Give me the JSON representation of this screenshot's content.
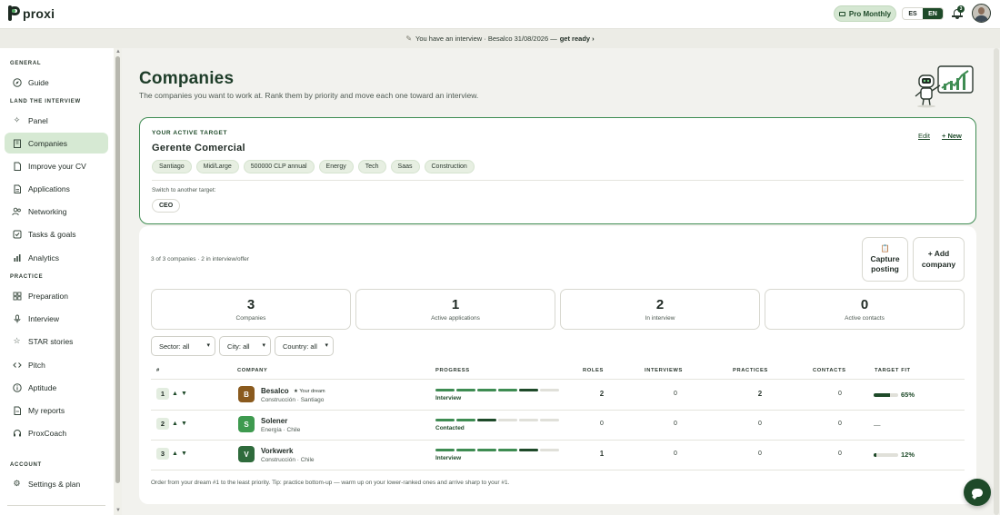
{
  "app": {
    "brand": "proxi"
  },
  "topbar": {
    "plan_label": "Pro Monthly",
    "lang_es": "ES",
    "lang_en": "EN",
    "notifications": "3"
  },
  "banner": {
    "text": "You have an interview · Besalco 31/08/2026 —",
    "cta": "get ready ›"
  },
  "sidebar": {
    "sections": {
      "general": "GENERAL",
      "land": "LAND THE INTERVIEW",
      "practice": "PRACTICE",
      "account": "ACCOUNT"
    },
    "items": [
      {
        "label": "Guide",
        "icon": "compass-icon"
      },
      {
        "label": "Panel",
        "icon": "sparkle-icon"
      },
      {
        "label": "Companies",
        "icon": "building-icon",
        "active": true
      },
      {
        "label": "Improve your CV",
        "icon": "document-icon"
      },
      {
        "label": "Applications",
        "icon": "file-icon"
      },
      {
        "label": "Networking",
        "icon": "people-icon"
      },
      {
        "label": "Tasks & goals",
        "icon": "checkbox-icon"
      },
      {
        "label": "Analytics",
        "icon": "bar-chart-icon"
      },
      {
        "label": "Preparation",
        "icon": "grid-icon"
      },
      {
        "label": "Interview",
        "icon": "microphone-icon"
      },
      {
        "label": "STAR stories",
        "icon": "star-icon"
      },
      {
        "label": "Pitch",
        "icon": "code-icon"
      },
      {
        "label": "Aptitude",
        "icon": "info-circle-icon"
      },
      {
        "label": "My reports",
        "icon": "report-icon"
      },
      {
        "label": "ProxCoach",
        "icon": "headset-icon"
      },
      {
        "label": "Settings & plan",
        "icon": "gear-icon"
      }
    ]
  },
  "page": {
    "title": "Companies",
    "subtitle": "The companies you want to work at. Rank them by priority and move each one toward an interview."
  },
  "target": {
    "label": "YOUR ACTIVE TARGET",
    "title": "Gerente Comercial",
    "edit": "Edit",
    "new": "+ New",
    "chips": [
      "Santiago",
      "Mid/Large",
      "500000 CLP annual",
      "Energy",
      "Tech",
      "Saas",
      "Construction"
    ],
    "switch_label": "Switch to another target:",
    "other": "CEO"
  },
  "summary": {
    "count_text": "3 of 3 companies · 2 in interview/offer",
    "capture_line1": "Capture",
    "capture_line2": "posting",
    "add_line1": "+ Add",
    "add_line2": "company"
  },
  "stats": [
    {
      "value": "3",
      "label": "Companies"
    },
    {
      "value": "1",
      "label": "Active applications"
    },
    {
      "value": "2",
      "label": "In interview"
    },
    {
      "value": "0",
      "label": "Active contacts"
    }
  ],
  "filters": {
    "sector": "Sector: all",
    "city": "City: all",
    "country": "Country: all"
  },
  "table": {
    "headers": {
      "rank": "#",
      "company": "COMPANY",
      "progress": "PROGRESS",
      "roles": "ROLES",
      "interviews": "INTERVIEWS",
      "practices": "PRACTICES",
      "contacts": "CONTACTS",
      "fit": "TARGET FIT"
    },
    "rows": [
      {
        "rank": "1",
        "initial": "B",
        "logo_color": "#8a5a1e",
        "name": "Besalco",
        "dream": "★ Your dream",
        "meta": "Construcción · Santiago",
        "stage": "Interview",
        "stage_step": 5,
        "roles": "2",
        "interviews": "0",
        "practices": "2",
        "contacts": "0",
        "fit": "65%",
        "fit_value": 0.65
      },
      {
        "rank": "2",
        "initial": "S",
        "logo_color": "#3e9a4f",
        "name": "Solener",
        "dream": "",
        "meta": "Energía · Chile",
        "stage": "Contacted",
        "stage_step": 3,
        "roles": "0",
        "interviews": "0",
        "practices": "0",
        "contacts": "0",
        "fit": "—",
        "fit_value": null
      },
      {
        "rank": "3",
        "initial": "V",
        "logo_color": "#2f6b3c",
        "name": "Vorkwerk",
        "dream": "",
        "meta": "Construcción · Chile",
        "stage": "Interview",
        "stage_step": 5,
        "roles": "1",
        "interviews": "0",
        "practices": "0",
        "contacts": "0",
        "fit": "12%",
        "fit_value": 0.12
      }
    ],
    "up": "▲",
    "down": "▼"
  },
  "footer_note": "Order from your dream #1 to the least priority. Tip: practice bottom-up — warm up on your lower-ranked ones and arrive sharp to your #1.",
  "colors": {
    "accent": "#1e4a29",
    "progress": "#3e8c52",
    "active_nav": "#d6e9d3"
  }
}
